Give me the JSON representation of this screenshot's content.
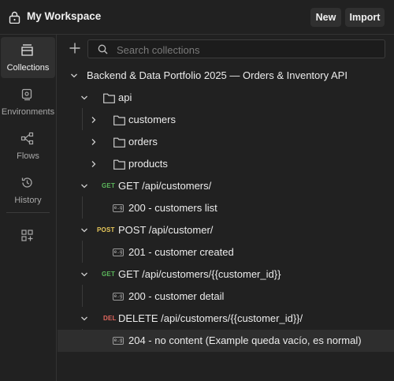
{
  "header": {
    "workspace_name": "My Workspace",
    "new_label": "New",
    "import_label": "Import"
  },
  "sidebar": {
    "items": [
      {
        "label": "Collections",
        "icon": "collections-icon",
        "active": true
      },
      {
        "label": "Environments",
        "icon": "environments-icon",
        "active": false
      },
      {
        "label": "Flows",
        "icon": "flows-icon",
        "active": false
      },
      {
        "label": "History",
        "icon": "history-icon",
        "active": false
      }
    ]
  },
  "search": {
    "placeholder": "Search collections"
  },
  "tree": {
    "collection": "Backend & Data Portfolio 2025 — Orders & Inventory API",
    "folder_api": "api",
    "folders": [
      "customers",
      "orders",
      "products"
    ],
    "requests": [
      {
        "method": "GET",
        "name": "GET /api/customers/",
        "example": "200 - customers list"
      },
      {
        "method": "POST",
        "name": "POST /api/customer/",
        "example": "201 - customer created"
      },
      {
        "method": "GET",
        "name": "GET /api/customers/{{customer_id}}",
        "example": "200 - customer detail"
      },
      {
        "method": "DEL",
        "name": "DELETE /api/customers/{{customer_id}}/",
        "example": "204 - no content (Example queda vacío, es normal)"
      }
    ]
  },
  "colors": {
    "background": "#212121",
    "get": "#5cb85c",
    "post": "#e8c85a",
    "delete": "#e0675e"
  }
}
